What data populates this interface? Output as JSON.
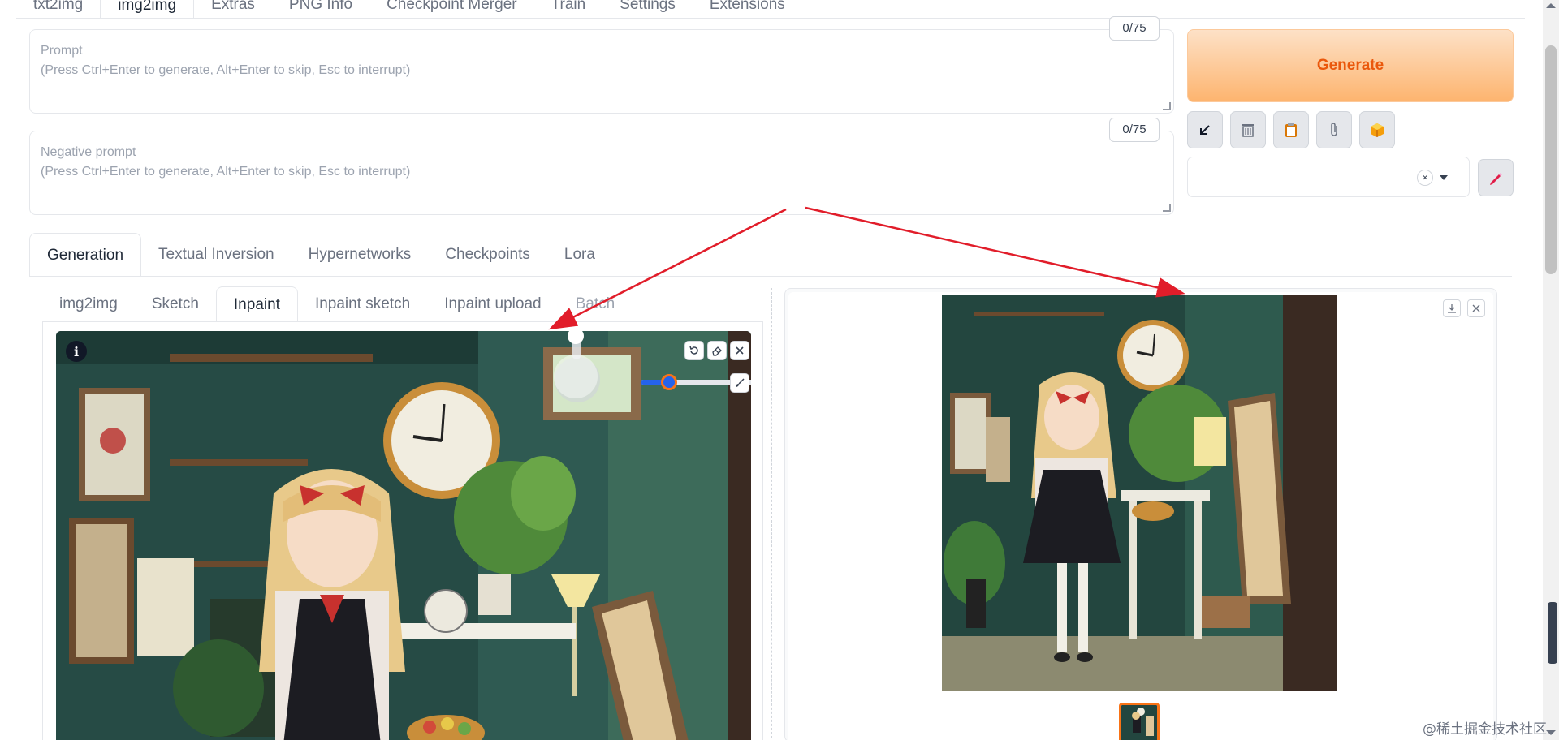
{
  "top_tabs": [
    {
      "label": "txt2img",
      "active": false
    },
    {
      "label": "img2img",
      "active": true
    },
    {
      "label": "Extras",
      "active": false
    },
    {
      "label": "PNG Info",
      "active": false
    },
    {
      "label": "Checkpoint Merger",
      "active": false
    },
    {
      "label": "Train",
      "active": false
    },
    {
      "label": "Settings",
      "active": false
    },
    {
      "label": "Extensions",
      "active": false
    }
  ],
  "prompt": {
    "label": "Prompt",
    "hint": "(Press Ctrl+Enter to generate, Alt+Enter to skip, Esc to interrupt)",
    "token_count": "0/75"
  },
  "negative_prompt": {
    "label": "Negative prompt",
    "hint": "(Press Ctrl+Enter to generate, Alt+Enter to skip, Esc to interrupt)",
    "token_count": "0/75"
  },
  "generate_label": "Generate",
  "tool_icons": [
    "arrow-down-left-icon",
    "trash-icon",
    "clipboard-icon",
    "paperclip-icon",
    "package-icon"
  ],
  "style_select": {
    "value": "",
    "clear_icon": "×"
  },
  "sub_tabs": [
    {
      "label": "Generation",
      "active": true
    },
    {
      "label": "Textual Inversion",
      "active": false
    },
    {
      "label": "Hypernetworks",
      "active": false
    },
    {
      "label": "Checkpoints",
      "active": false
    },
    {
      "label": "Lora",
      "active": false
    }
  ],
  "mode_tabs": [
    {
      "label": "img2img",
      "active": false
    },
    {
      "label": "Sketch",
      "active": false
    },
    {
      "label": "Inpaint",
      "active": true
    },
    {
      "label": "Inpaint sketch",
      "active": false
    },
    {
      "label": "Inpaint upload",
      "active": false
    },
    {
      "label": "Batch",
      "active": false
    }
  ],
  "canvas": {
    "info_label": "i",
    "brush_size_fraction": 0.22
  },
  "watermark": "@稀土掘金技术社区",
  "colors": {
    "accent": "#ea580c",
    "slider": "#2563eb",
    "arrow": "#e11d2a",
    "thumb_border": "#f97316"
  }
}
